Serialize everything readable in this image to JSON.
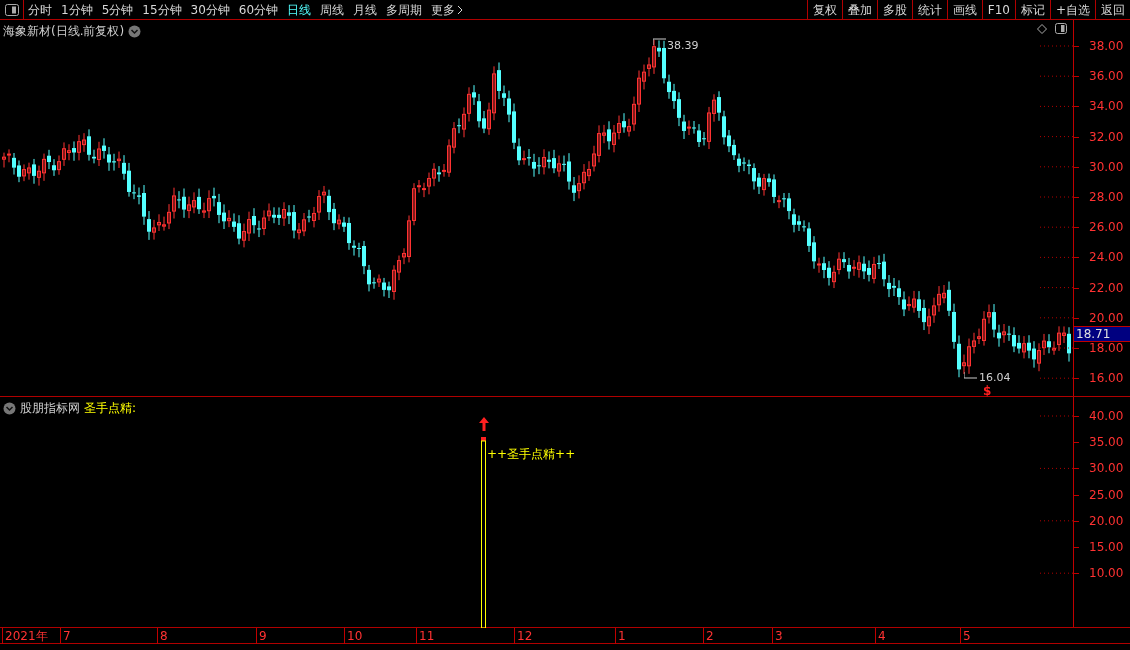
{
  "toolbar": {
    "periods": [
      {
        "label": "分时",
        "selected": false
      },
      {
        "label": "1分钟",
        "selected": false
      },
      {
        "label": "5分钟",
        "selected": false
      },
      {
        "label": "15分钟",
        "selected": false
      },
      {
        "label": "30分钟",
        "selected": false
      },
      {
        "label": "60分钟",
        "selected": false
      },
      {
        "label": "日线",
        "selected": true
      },
      {
        "label": "周线",
        "selected": false
      },
      {
        "label": "月线",
        "selected": false
      },
      {
        "label": "多周期",
        "selected": false
      },
      {
        "label": "更多",
        "selected": false
      }
    ],
    "buttons": [
      "复权",
      "叠加",
      "多股",
      "统计",
      "画线",
      "F10",
      "标记",
      "+自选",
      "返回"
    ]
  },
  "price_chart": {
    "title": "海象新材(日线.前复权)",
    "y_ticks": [
      "38.00",
      "36.00",
      "34.00",
      "32.00",
      "30.00",
      "28.00",
      "26.00",
      "24.00",
      "22.00",
      "20.00",
      "18.00",
      "16.00"
    ],
    "high_label": "38.39",
    "low_label": "16.04",
    "price_tag": "18.71",
    "signal_mark": "$"
  },
  "indicator": {
    "source": "股朋指标网",
    "name": "圣手点精:",
    "signal_label": "++圣手点精++",
    "y_ticks": [
      "40.00",
      "35.00",
      "30.00",
      "25.00",
      "20.00",
      "15.00",
      "10.00"
    ]
  },
  "date_axis": [
    "2021年",
    "7",
    "8",
    "9",
    "10",
    "11",
    "12",
    "1",
    "2",
    "3",
    "4",
    "5"
  ]
}
